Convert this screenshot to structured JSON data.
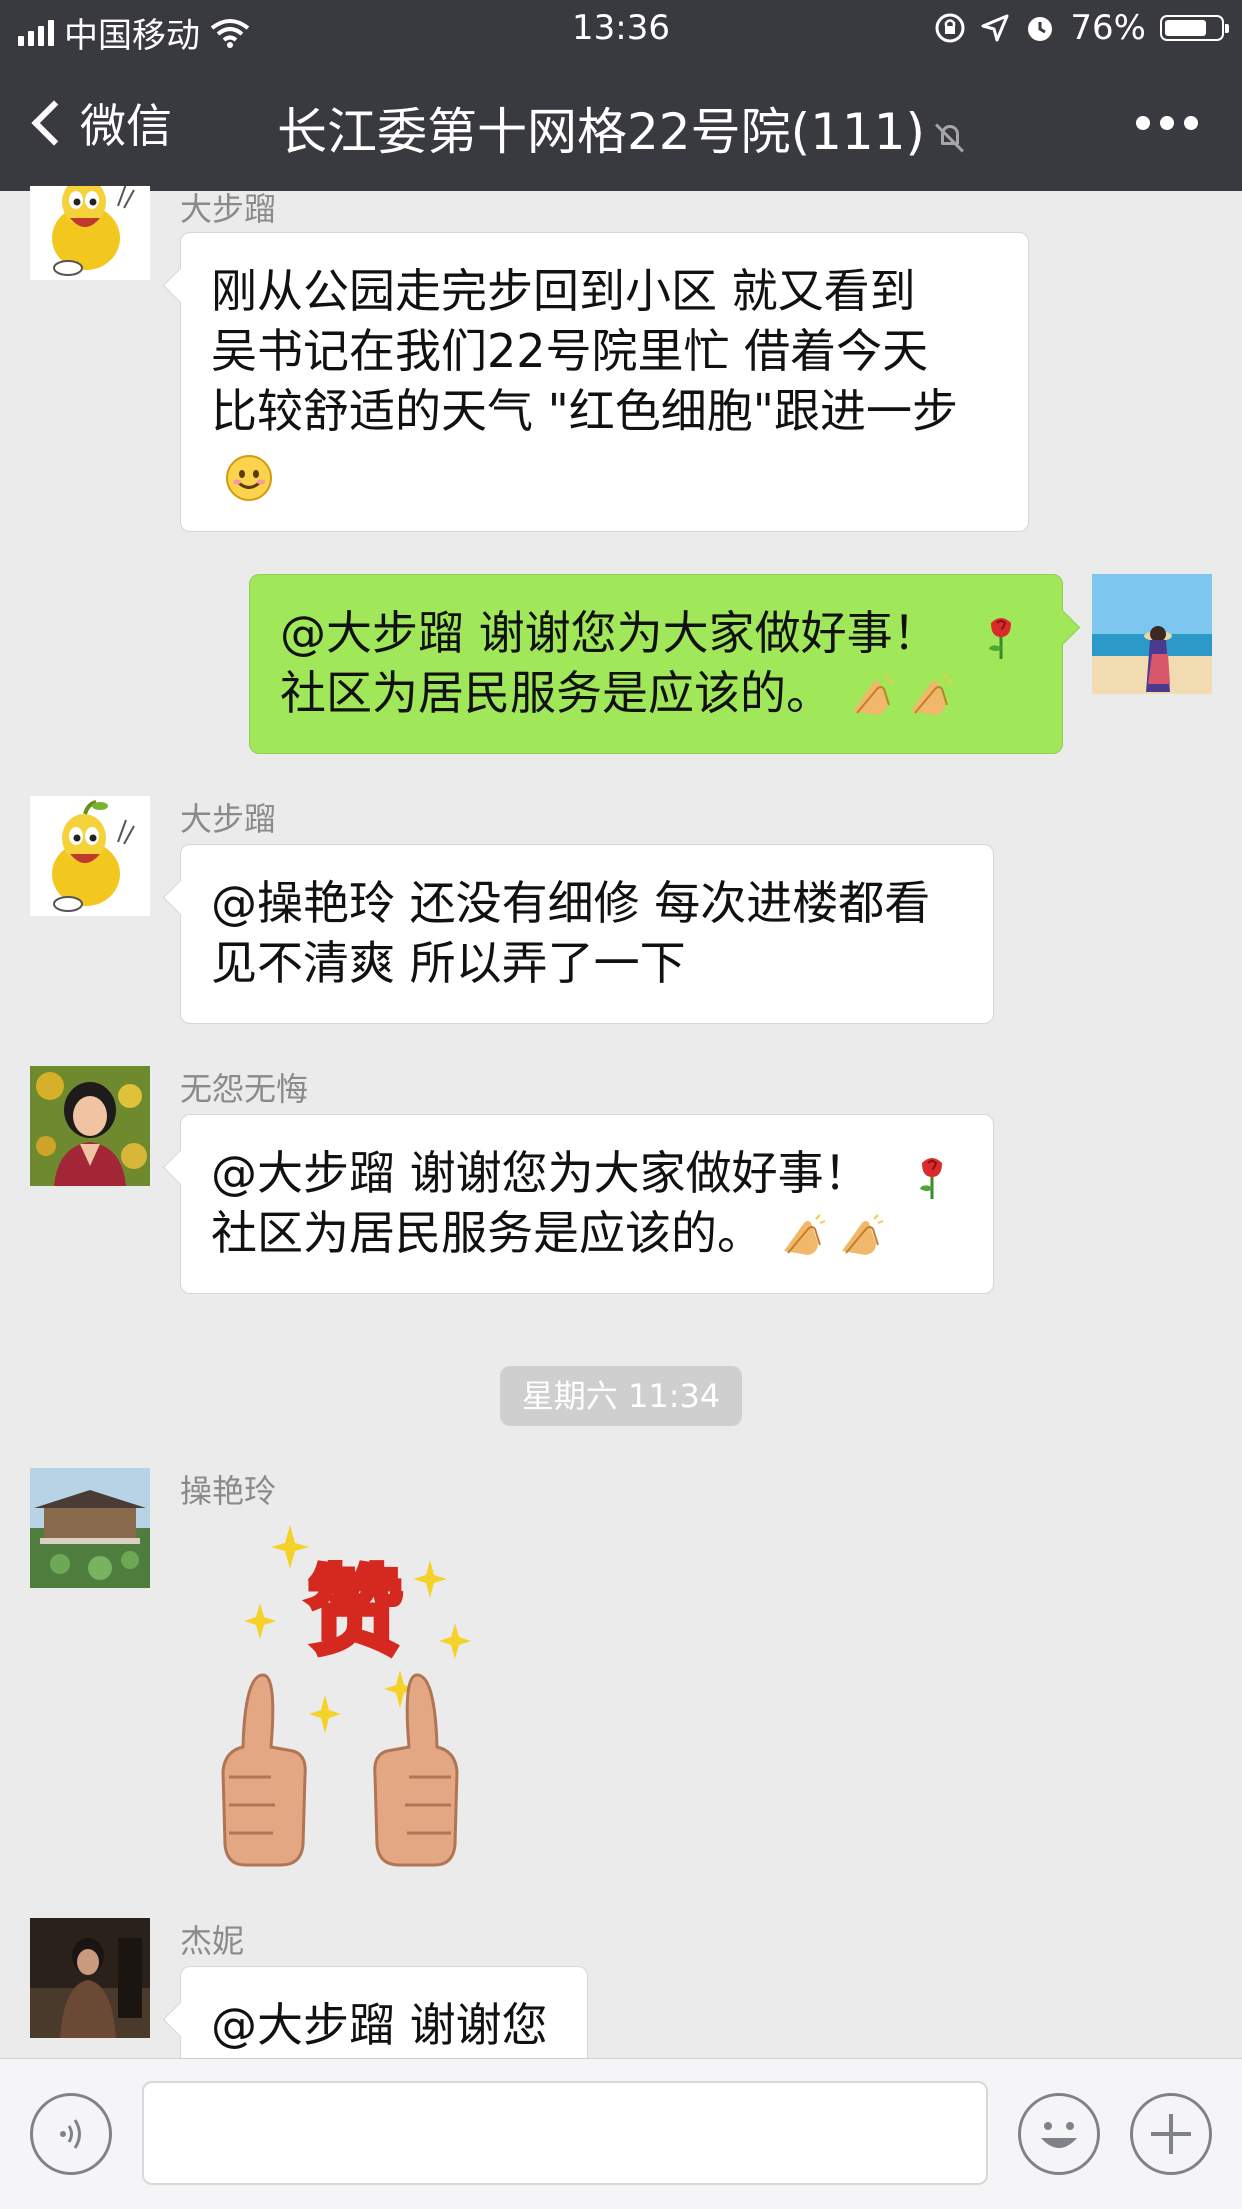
{
  "status_bar": {
    "carrier": "中国移动",
    "time": "13:36",
    "battery_percent": "76%",
    "battery_level": 0.76
  },
  "nav": {
    "back_label": "微信",
    "title": "长江委第十网格22号院(111)"
  },
  "messages": [
    {
      "sender": "大步蹓",
      "text": "刚从公园走完步回到小区 就又看到\n吴书记在我们22号院里忙 借着今天\n比较舒适的天气 \"红色细胞\"跟进一步",
      "emoji": "smile"
    },
    {
      "sender": "",
      "text": "@大步蹓 谢谢您为大家做好事！",
      "text2": "社区为居民服务是应该的。",
      "emoji": "rose, clap, clap"
    },
    {
      "sender": "大步蹓",
      "text": "@操艳玲 还没有细修 每次进楼都看\n见不清爽 所以弄了一下"
    },
    {
      "sender": "无怨无悔",
      "text": "@大步蹓 谢谢您为大家做好事！",
      "text2": "社区为居民服务是应该的。",
      "emoji": "rose, clap, clap"
    },
    {
      "sender": "操艳玲",
      "sticker": "赞"
    },
    {
      "sender": "杰妮",
      "text": "@大步蹓 谢谢您"
    }
  ],
  "timestamp": "星期六 11:34",
  "colors": {
    "nav_bg": "#393a3f",
    "chat_bg": "#ebebeb",
    "outgoing_bubble": "#a0e75a",
    "incoming_bubble": "#ffffff"
  }
}
